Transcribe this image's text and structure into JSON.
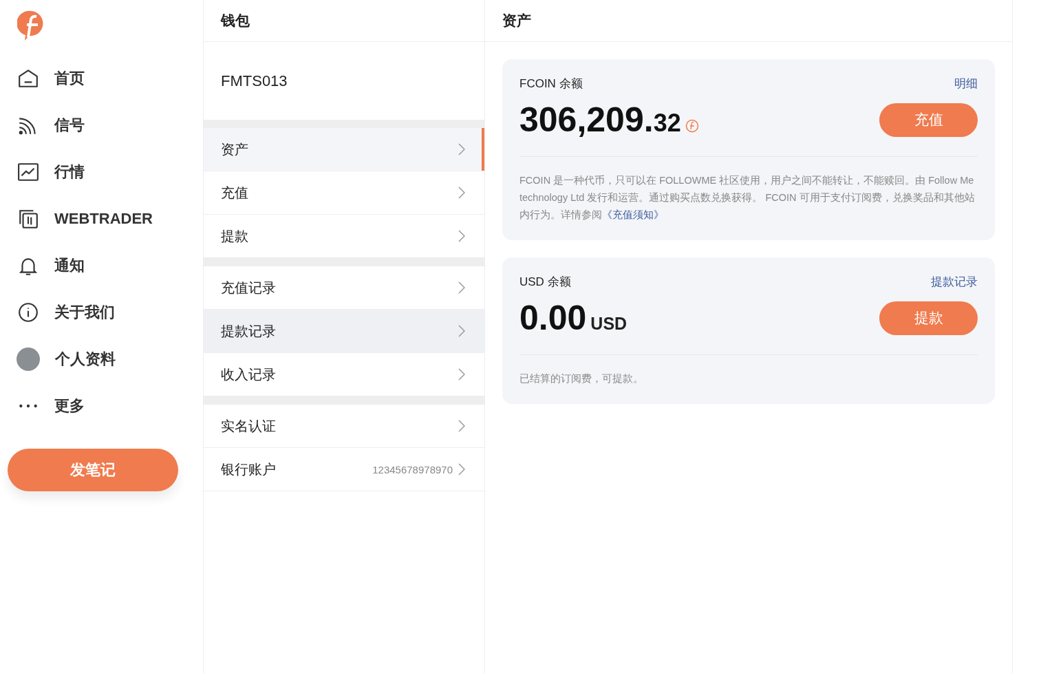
{
  "sidebar": {
    "items": [
      {
        "kind": "home",
        "label": "首页"
      },
      {
        "kind": "signal",
        "label": "信号"
      },
      {
        "kind": "chart",
        "label": "行情"
      },
      {
        "kind": "trader",
        "label": "WEBTRADER"
      },
      {
        "kind": "bell",
        "label": "通知"
      },
      {
        "kind": "info",
        "label": "关于我们"
      },
      {
        "kind": "avatar",
        "label": "个人资料"
      },
      {
        "kind": "more",
        "label": "更多"
      }
    ],
    "post_button": "发笔记"
  },
  "wallet": {
    "title": "钱包",
    "account": "FMTS013",
    "groups": [
      [
        {
          "label": "资产",
          "selected": true
        },
        {
          "label": "充值",
          "selected": false
        },
        {
          "label": "提款",
          "selected": false
        }
      ],
      [
        {
          "label": "充值记录",
          "selected": false
        },
        {
          "label": "提款记录",
          "selected": false,
          "hovered": true
        },
        {
          "label": "收入记录",
          "selected": false
        }
      ],
      [
        {
          "label": "实名认证",
          "selected": false
        },
        {
          "label": "银行账户",
          "value": "12345678978970",
          "selected": false
        }
      ]
    ]
  },
  "assets": {
    "title": "资产",
    "cards": [
      {
        "kind": "coin",
        "label": "FCOIN 余额",
        "link": "明细",
        "amount_main": "306,209.",
        "amount_small": "32",
        "button": "充值",
        "description": "FCOIN 是一种代币，只可以在 FOLLOWME 社区使用，用户之间不能转让，不能赎回。由 Follow Me technology Ltd 发行和运营。通过购买点数兑换获得。 FCOIN 可用于支付订阅费，兑换奖品和其他站内行为。详情参阅",
        "description_link": "《充值须知》"
      },
      {
        "kind": "currency",
        "label": "USD 余额",
        "link": "提款记录",
        "amount_main": "0.00",
        "unit": "USD",
        "button": "提款",
        "description": "已结算的订阅费，可提款。"
      }
    ]
  }
}
